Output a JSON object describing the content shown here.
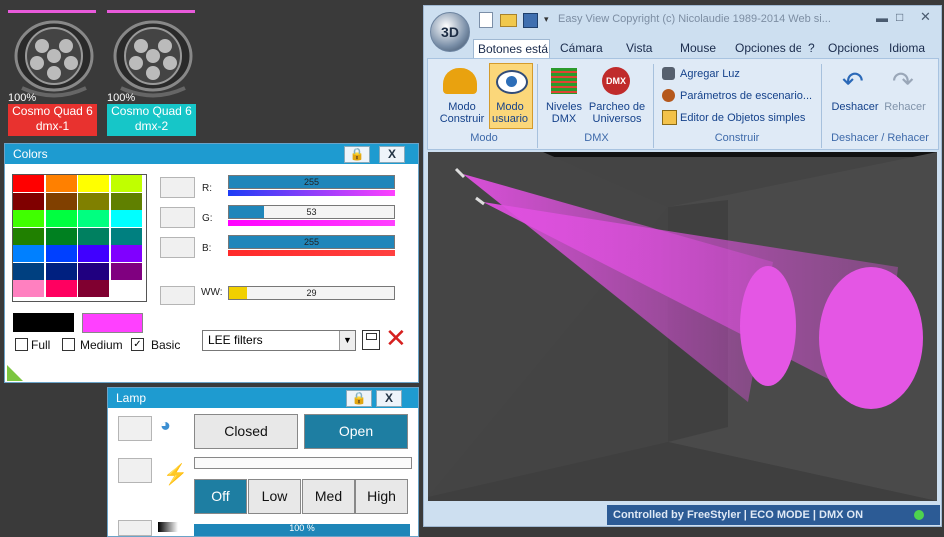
{
  "fixtures": [
    {
      "percent": "100%",
      "name": "Cosmo Quad 6",
      "address": "dmx-1",
      "label_color": "#e8322f"
    },
    {
      "percent": "100%",
      "name": "Cosmo Quad 6",
      "address": "dmx-2",
      "label_color": "#16c6c8"
    }
  ],
  "colors_panel": {
    "title": "Colors",
    "lock_icon": "lock-icon",
    "close_label": "X",
    "palette": [
      "#ff0000",
      "#ff8000",
      "#ffff00",
      "#c0ff00",
      "#800000",
      "#804000",
      "#808000",
      "#608000",
      "#40ff00",
      "#00ff40",
      "#00ff80",
      "#00ffff",
      "#208000",
      "#008020",
      "#008060",
      "#008080",
      "#0080ff",
      "#0040ff",
      "#4000ff",
      "#8000ff",
      "#004080",
      "#002080",
      "#200080",
      "#800080",
      "#ff80c0",
      "#ff0060",
      "#800030",
      "#ffffff"
    ],
    "current_color": "#000000",
    "target_color": "#ff40ff",
    "channels": {
      "r": {
        "label": "R:",
        "value": "255",
        "level": 1.0,
        "gradient": "linear-gradient(to right,#1c3cf5,#ff40ff)"
      },
      "g": {
        "label": "G:",
        "value": "53",
        "level": 0.21,
        "gradient": "linear-gradient(to right,#ff00ff,#ff40ff)"
      },
      "b": {
        "label": "B:",
        "value": "255",
        "level": 1.0,
        "gradient": "linear-gradient(to right,#ff2a2a,#ff4040)"
      },
      "ww": {
        "label": "WW:",
        "value": "29",
        "level": 0.11
      }
    },
    "view_options": [
      {
        "label": "Full",
        "checked": false
      },
      {
        "label": "Medium",
        "checked": false
      },
      {
        "label": "Basic",
        "checked": true
      }
    ],
    "filter_select": "LEE filters"
  },
  "lamp_panel": {
    "title": "Lamp",
    "close_label": "X",
    "shutter": [
      "Closed",
      "Open"
    ],
    "shutter_active": "Open",
    "strobe": [
      "Off",
      "Low",
      "Med",
      "High"
    ],
    "strobe_active": "Off",
    "dimmer_text": "100 %"
  },
  "app": {
    "title": "Easy View   Copyright (c) Nicolaudie 1989-2014   Web si...",
    "logo": "3D",
    "tabs": [
      "Botones está",
      "Cámara",
      "Vista",
      "Mouse",
      "Opciones de",
      "?",
      "Opciones",
      "Idioma"
    ],
    "ribbon": {
      "modo": {
        "group": "Modo",
        "construir": "Modo\nConstruir",
        "usuario": "Modo\nusuario"
      },
      "dmx": {
        "group": "DMX",
        "niveles": "Niveles\nDMX",
        "parcheo": "Parcheo de\nUniversos"
      },
      "construir": {
        "group": "Construir",
        "agregar": "Agregar Luz",
        "parametros": "Parámetros de escenario...",
        "editor": "Editor de Objetos simples"
      },
      "deshacer": {
        "group": "Deshacer / Rehacer",
        "undo": "Deshacer",
        "redo": "Rehacer"
      }
    },
    "status": {
      "text": "Controlled by FreeStyler  |  ECO MODE  |  DMX ON"
    },
    "beam_color": "#e050e0"
  }
}
